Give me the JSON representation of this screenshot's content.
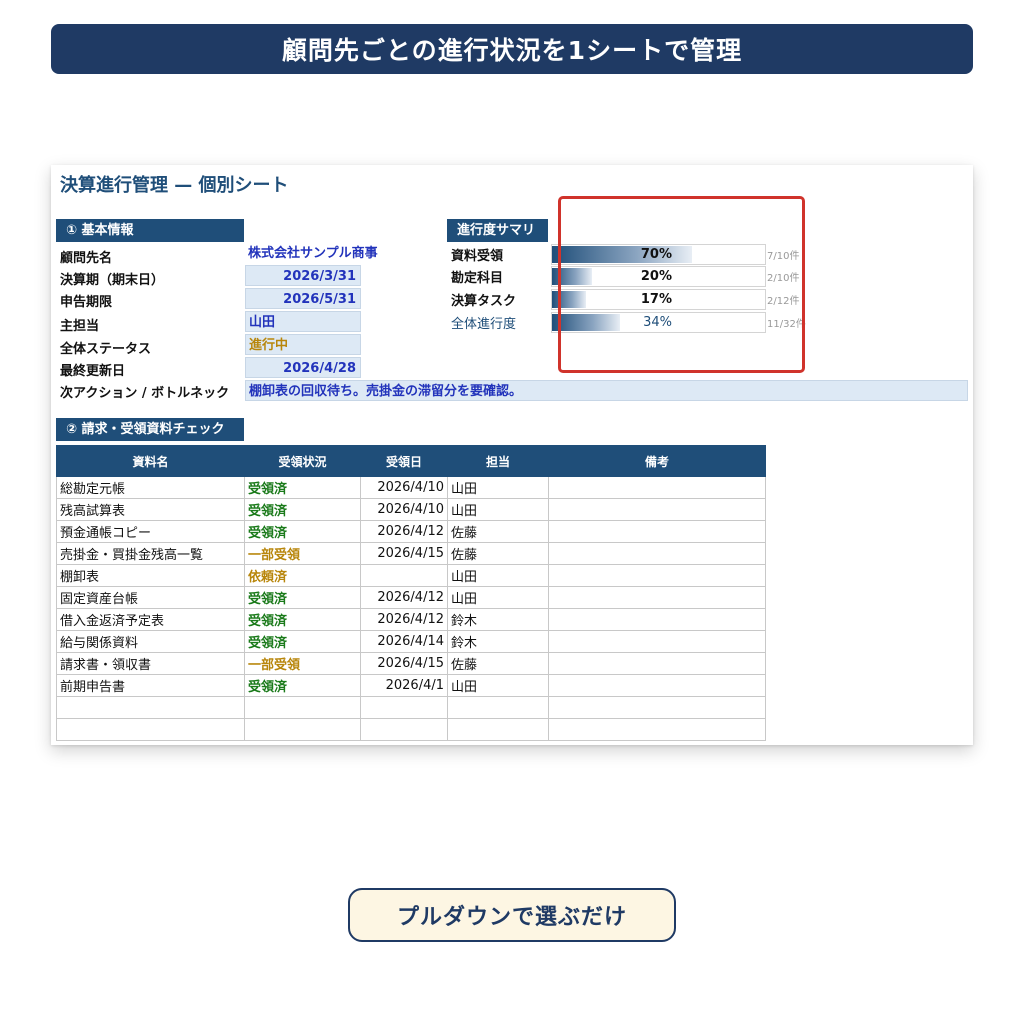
{
  "banner": {
    "title": "顧問先ごとの進行状況を1シートで管理"
  },
  "sheet": {
    "title": "決算進行管理 — 個別シート",
    "basic": {
      "header": "① 基本情報",
      "labels": {
        "client": "顧問先名",
        "fiscal": "決算期（期末日）",
        "deadline": "申告期限",
        "owner": "主担当",
        "status": "全体ステータス",
        "updated": "最終更新日",
        "next_action": "次アクション / ボトルネック"
      },
      "values": {
        "client": "株式会社サンプル商事",
        "fiscal": "2026/3/31",
        "deadline": "2026/5/31",
        "owner": "山田",
        "status": "進行中",
        "updated": "2026/4/28",
        "next_action": "棚卸表の回収待ち。売掛金の滞留分を要確認。"
      }
    },
    "summary": {
      "header": "進行度サマリ",
      "rows": [
        {
          "label": "資料受領",
          "pct": "70%",
          "fraction": 0.7,
          "count": "7/10件"
        },
        {
          "label": "勘定科目",
          "pct": "20%",
          "fraction": 0.2,
          "count": "2/10件"
        },
        {
          "label": "決算タスク",
          "pct": "17%",
          "fraction": 0.17,
          "count": "2/12件"
        },
        {
          "label": "全体進行度",
          "pct": "34%",
          "fraction": 0.34,
          "count": "11/32件"
        }
      ]
    },
    "documents": {
      "header": "② 請求・受領資料チェック",
      "columns": [
        "資料名",
        "受領状況",
        "受領日",
        "担当",
        "備考"
      ],
      "rows": [
        {
          "name": "総勘定元帳",
          "status": "受領済",
          "date": "2026/4/10",
          "owner": "山田",
          "note": ""
        },
        {
          "name": "残高試算表",
          "status": "受領済",
          "date": "2026/4/10",
          "owner": "山田",
          "note": ""
        },
        {
          "name": "預金通帳コピー",
          "status": "受領済",
          "date": "2026/4/12",
          "owner": "佐藤",
          "note": ""
        },
        {
          "name": "売掛金・買掛金残高一覧",
          "status": "一部受領",
          "date": "2026/4/15",
          "owner": "佐藤",
          "note": ""
        },
        {
          "name": "棚卸表",
          "status": "依頼済",
          "date": "",
          "owner": "山田",
          "note": ""
        },
        {
          "name": "固定資産台帳",
          "status": "受領済",
          "date": "2026/4/12",
          "owner": "山田",
          "note": ""
        },
        {
          "name": "借入金返済予定表",
          "status": "受領済",
          "date": "2026/4/12",
          "owner": "鈴木",
          "note": ""
        },
        {
          "name": "給与関係資料",
          "status": "受領済",
          "date": "2026/4/14",
          "owner": "鈴木",
          "note": ""
        },
        {
          "name": "請求書・領収書",
          "status": "一部受領",
          "date": "2026/4/15",
          "owner": "佐藤",
          "note": ""
        },
        {
          "name": "前期申告書",
          "status": "受領済",
          "date": "2026/4/1",
          "owner": "山田",
          "note": ""
        },
        {
          "name": "",
          "status": "",
          "date": "",
          "owner": "",
          "note": ""
        },
        {
          "name": "",
          "status": "",
          "date": "",
          "owner": "",
          "note": ""
        }
      ]
    }
  },
  "callout": {
    "text": "プルダウンで選ぶだけ"
  },
  "colors": {
    "navy": "#1f3a64",
    "header_blue": "#1f4e79",
    "highlight_red": "#d0332b",
    "status_done": "#1a7a1a",
    "status_partial": "#b8860b",
    "value_blue": "#2233bb"
  }
}
